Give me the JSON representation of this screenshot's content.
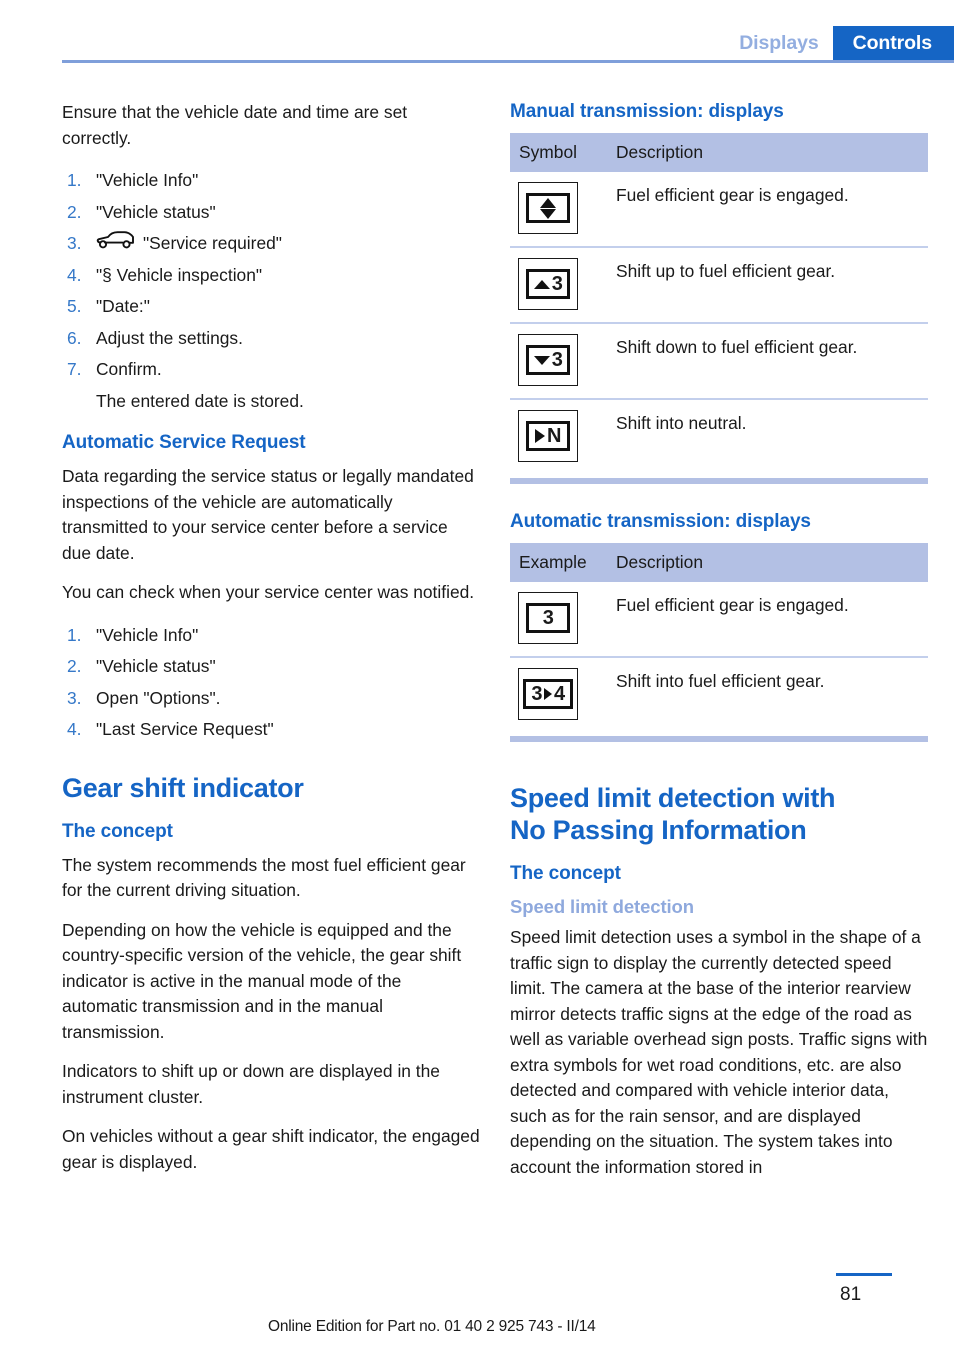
{
  "header": {
    "tab_inactive": "Displays",
    "tab_active": "Controls",
    "accent_blue": "#1565c5",
    "light_blue": "#b3c0e4",
    "muted_blue": "#8fa9dd"
  },
  "left": {
    "intro": "Ensure that the vehicle date and time are set correctly.",
    "date_steps": [
      {
        "num": "1.",
        "text": "\"Vehicle Info\"",
        "icon": ""
      },
      {
        "num": "2.",
        "text": "\"Vehicle status\"",
        "icon": ""
      },
      {
        "num": "3.",
        "text": "\"Service required\"",
        "icon": "car-side-icon"
      },
      {
        "num": "4.",
        "text": "\"§ Vehicle inspection\"",
        "icon": ""
      },
      {
        "num": "5.",
        "text": "\"Date:\"",
        "icon": ""
      },
      {
        "num": "6.",
        "text": "Adjust the settings.",
        "icon": ""
      },
      {
        "num": "7.",
        "text": "Confirm.",
        "icon": ""
      },
      {
        "num": "",
        "text": "The entered date is stored.",
        "icon": ""
      }
    ],
    "asr_heading": "Automatic Service Request",
    "asr_para1": "Data regarding the service status or legally mandated inspections of the vehicle are automatically transmitted to your service center before a service due date.",
    "asr_para2": "You can check when your service center was notified.",
    "asr_steps": [
      {
        "num": "1.",
        "text": "\"Vehicle Info\""
      },
      {
        "num": "2.",
        "text": "\"Vehicle status\""
      },
      {
        "num": "3.",
        "text": "Open \"Options\"."
      },
      {
        "num": "4.",
        "text": "\"Last Service Request\""
      }
    ],
    "gsi_title": "Gear shift indicator",
    "gsi_concept_heading": "The concept",
    "gsi_para1": "The system recommends the most fuel efficient gear for the current driving situation.",
    "gsi_para2": "Depending on how the vehicle is equipped and the country-specific version of the vehicle, the gear shift indicator is active in the manual mode of the automatic transmission and in the manual transmission.",
    "gsi_para3": "Indicators to shift up or down are displayed in the instrument cluster.",
    "gsi_para4": "On vehicles without a gear shift indicator, the engaged gear is displayed."
  },
  "right": {
    "manual_heading": "Manual transmission: displays",
    "manual_table": {
      "col1": "Symbol",
      "col2": "Description",
      "rows": [
        {
          "symbol": "up-down-arrow-icon",
          "gear": "",
          "description": "Fuel efficient gear is engaged."
        },
        {
          "symbol": "arrow-up-icon",
          "gear": "3",
          "description": "Shift up to fuel efficient gear."
        },
        {
          "symbol": "arrow-down-icon",
          "gear": "3",
          "description": "Shift down to fuel efficient gear."
        },
        {
          "symbol": "arrow-right-icon",
          "gear": "N",
          "description": "Shift into neutral."
        }
      ]
    },
    "auto_heading": "Automatic transmission: displays",
    "auto_table": {
      "col1": "Example",
      "col2": "Description",
      "rows": [
        {
          "symbol": "gear-number",
          "gear": "3",
          "description": "Fuel efficient gear is engaged."
        },
        {
          "symbol": "gear-shift-arrow",
          "gear_from": "3",
          "gear_to": "4",
          "description": "Shift into fuel efficient gear."
        }
      ]
    },
    "sl_title_line1": "Speed limit detection with",
    "sl_title_line2": "No Passing Information",
    "sl_concept_heading": "The concept",
    "sl_subheading": "Speed limit detection",
    "sl_para1": "Speed limit detection uses a symbol in the shape of a traffic sign to display the currently detected speed limit. The camera at the base of the interior rearview mirror detects traffic signs at the edge of the road as well as variable overhead sign posts. Traffic signs with extra symbols for wet road conditions, etc. are also detected and compared with vehicle interior data, such as for the rain sensor, and are displayed depending on the situation. The system takes into account the information stored in"
  },
  "footer": {
    "edition_text": "Online Edition for Part no. 01 40 2 925 743 - II/14",
    "page_number": "81"
  }
}
